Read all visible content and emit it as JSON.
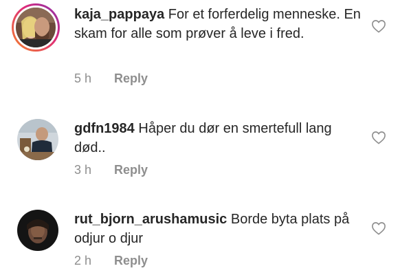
{
  "comments": [
    {
      "username": "kaja_pappaya",
      "text": "For et forferdelig menneske. En skam for alle som prøver å leve i fred.",
      "time": "5 h",
      "reply_label": "Reply",
      "has_story_ring": true
    },
    {
      "username": "gdfn1984",
      "text": "Håper du dør en smertefull lang død..",
      "time": "3 h",
      "reply_label": "Reply",
      "has_story_ring": false
    },
    {
      "username": "rut_bjorn_arushamusic",
      "text": "Borde byta plats på odjur o djur",
      "time": "2 h",
      "reply_label": "Reply",
      "has_story_ring": false
    }
  ],
  "icons": {
    "like": "heart-outline-icon"
  },
  "colors": {
    "text": "#262626",
    "muted": "#8e8e8e",
    "story_ring_start": "#f58529",
    "story_ring_end": "#dd2a7b"
  }
}
